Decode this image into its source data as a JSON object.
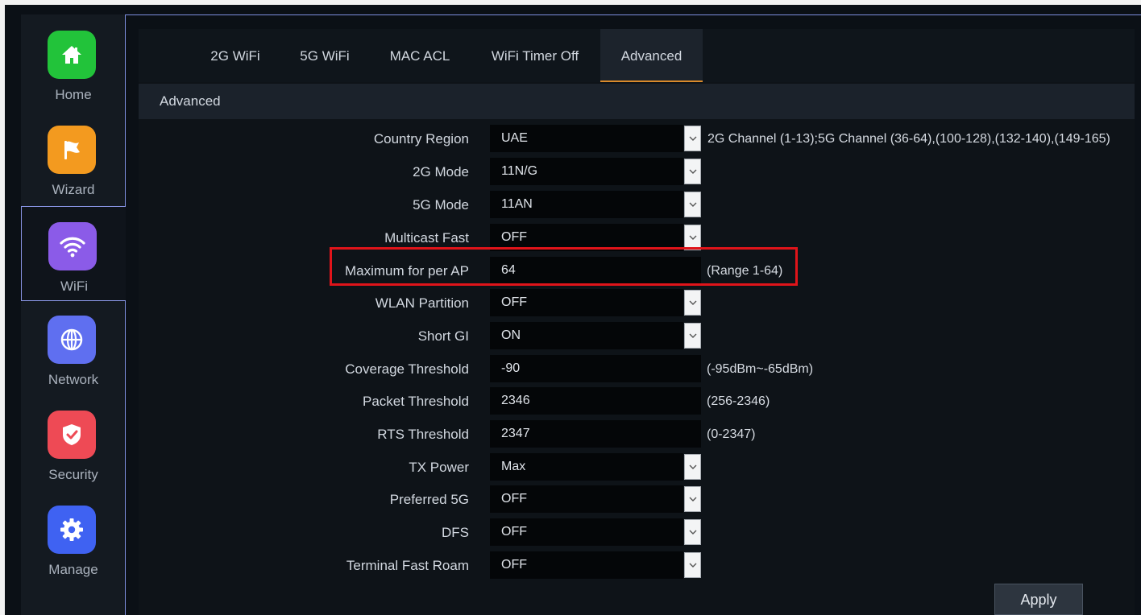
{
  "sidebar": {
    "items": [
      {
        "label": "Home",
        "icon": "home-icon",
        "color": "#22c33a"
      },
      {
        "label": "Wizard",
        "icon": "flag-icon",
        "color": "#f39a1f"
      },
      {
        "label": "WiFi",
        "icon": "wifi-icon",
        "color": "#8b5be8",
        "active": true
      },
      {
        "label": "Network",
        "icon": "globe-icon",
        "color": "#5f6ff0"
      },
      {
        "label": "Security",
        "icon": "shield-icon",
        "color": "#ee4a55"
      },
      {
        "label": "Manage",
        "icon": "gear-icon",
        "color": "#3f62f2"
      }
    ]
  },
  "tabs": [
    {
      "label": "2G WiFi"
    },
    {
      "label": "5G WiFi"
    },
    {
      "label": "MAC ACL"
    },
    {
      "label": "WiFi Timer Off"
    },
    {
      "label": "Advanced",
      "active": true
    }
  ],
  "section": {
    "title": "Advanced"
  },
  "form": {
    "rows": [
      {
        "label": "Country Region",
        "value": "UAE",
        "type": "select",
        "hint": "2G Channel (1-13);5G Channel (36-64),(100-128),(132-140),(149-165)"
      },
      {
        "label": "2G Mode",
        "value": "11N/G",
        "type": "select",
        "hint": ""
      },
      {
        "label": "5G Mode",
        "value": "11AN",
        "type": "select",
        "hint": ""
      },
      {
        "label": "Multicast Fast",
        "value": "OFF",
        "type": "select",
        "hint": ""
      },
      {
        "label": "Maximum for per AP",
        "value": "64",
        "type": "input",
        "hint": "(Range 1-64)"
      },
      {
        "label": "WLAN Partition",
        "value": "OFF",
        "type": "select",
        "hint": ""
      },
      {
        "label": "Short GI",
        "value": "ON",
        "type": "select",
        "hint": ""
      },
      {
        "label": "Coverage Threshold",
        "value": "-90",
        "type": "input",
        "hint": "(-95dBm~-65dBm)"
      },
      {
        "label": "Packet Threshold",
        "value": "2346",
        "type": "input",
        "hint": "(256-2346)"
      },
      {
        "label": "RTS Threshold",
        "value": "2347",
        "type": "input",
        "hint": "(0-2347)"
      },
      {
        "label": "TX Power",
        "value": "Max",
        "type": "select",
        "hint": ""
      },
      {
        "label": "Preferred 5G",
        "value": "OFF",
        "type": "select",
        "hint": ""
      },
      {
        "label": "DFS",
        "value": "OFF",
        "type": "select",
        "hint": ""
      },
      {
        "label": "Terminal Fast Roam",
        "value": "OFF",
        "type": "select",
        "hint": ""
      }
    ],
    "apply_label": "Apply"
  },
  "colors": {
    "highlight": "#e0141a",
    "tab_underline": "#d98a2b",
    "active_border": "#8a96e6"
  }
}
